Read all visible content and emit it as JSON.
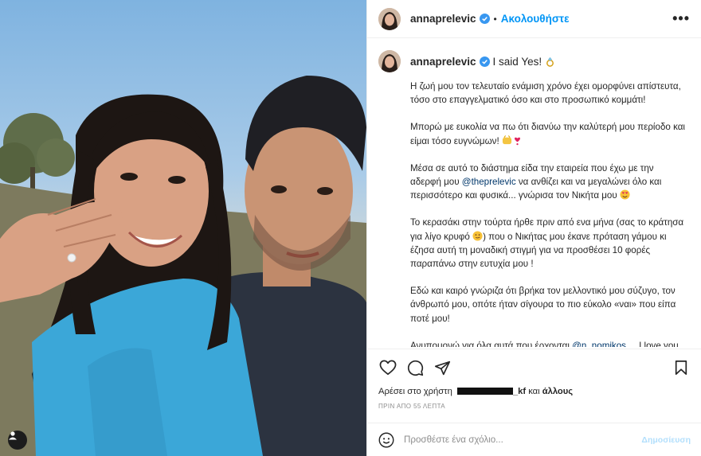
{
  "header": {
    "username": "annaprelevic",
    "separator": "•",
    "follow_label": "Ακολουθήστε",
    "more_label": "•••"
  },
  "caption": {
    "username": "annaprelevic",
    "title": "I said Yes!",
    "title_emoji": "ring-icon",
    "paragraphs": {
      "p1": "Η ζωή μου τον τελευταίο ενάμιση χρόνο έχει ομορφύνει απίστευτα, τόσο στο επαγγελματικό όσο και στο προσωπικό κομμάτι!",
      "p2": "Μπορώ με ευκολία να πω ότι διανύω την καλύτερή μου περίοδο και είμαι τόσο ευγνώμων!",
      "p3_before": "Μέσα σε αυτό το διάστημα είδα την εταιρεία που έχω με την αδερφή μου ",
      "p3_mention": "@theprelevic",
      "p3_after": " να ανθίζει και να μεγαλώνει όλο και περισσότερο και φυσικά... γνώρισα τον Νικήτα μου",
      "p4_before": "Το κερασάκι στην τούρτα ήρθε πριν από ενα μήνα (σας το κράτησα για λίγο κρυφό ",
      "p4_after": ") που ο Νικήτας μου έκανε πρόταση γάμου κι έζησα αυτή τη μοναδική στιγμή για να προσθέσει 10 φορές παραπάνω στην ευτυχία μου !",
      "p5": "Εδώ και καιρό γνώριζα ότι βρήκα τον μελλοντικό μου σύζυγο, τον άνθρωπό μου, οπότε ήταν σίγουρα το πιο εύκολο «ναι» που είπα ποτέ μου!",
      "p6_before": "Ανυπομονώ για όλα αυτά που έρχονται ",
      "p6_mention": "@n_nomikos",
      "p6_after": " ... I love you to the moon and back!"
    }
  },
  "actions": {
    "likes_prefix": "Αρέσει στο χρήστη",
    "likes_user_suffix": "_kf",
    "likes_and": "και",
    "likes_others": "άλλους",
    "timestamp": "ΠΡΙΝ ΑΠΟ 55 ΛΕΠΤΑ"
  },
  "comment": {
    "placeholder": "Προσθέστε ένα σχόλιο...",
    "publish_label": "Δημοσίευση"
  },
  "colors": {
    "accent": "#0095f6",
    "mention": "#00376b",
    "publish_disabled": "#b2dffc",
    "muted": "#8e8e8e",
    "shirt": "#3ba7d8"
  }
}
